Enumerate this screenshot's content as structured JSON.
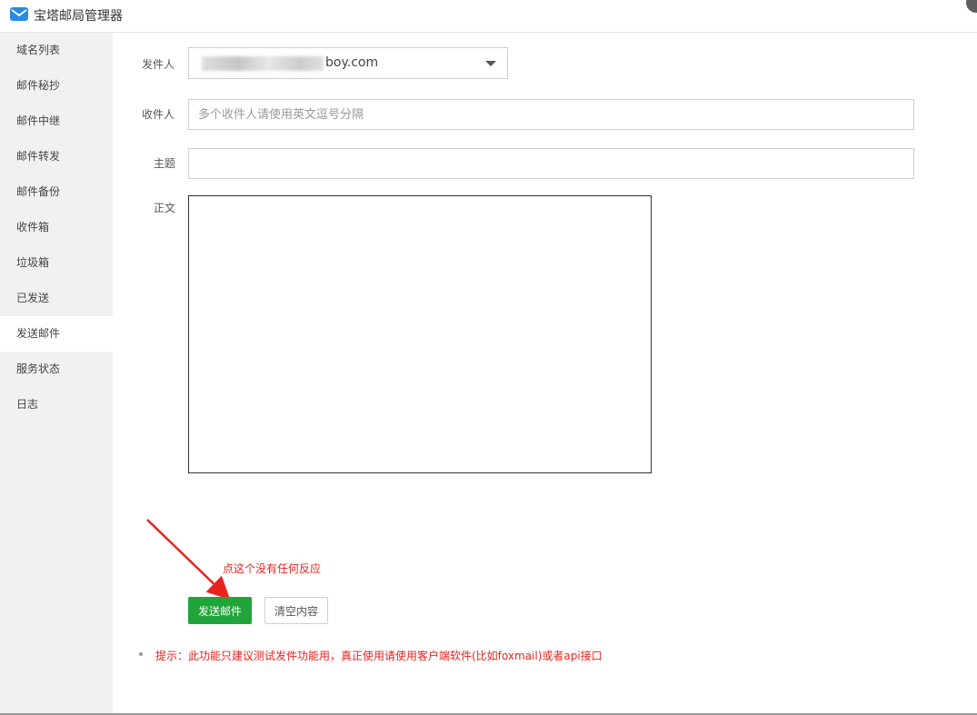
{
  "window": {
    "title": "宝塔邮局管理器",
    "app_icon": "mail-icon",
    "close_icon": "close-icon"
  },
  "sidebar": {
    "items": [
      {
        "label": "域名列表",
        "active": false
      },
      {
        "label": "邮件秘抄",
        "active": false
      },
      {
        "label": "邮件中继",
        "active": false
      },
      {
        "label": "邮件转发",
        "active": false
      },
      {
        "label": "邮件备份",
        "active": false
      },
      {
        "label": "收件箱",
        "active": false
      },
      {
        "label": "垃圾箱",
        "active": false
      },
      {
        "label": "已发送",
        "active": false
      },
      {
        "label": "发送邮件",
        "active": true
      },
      {
        "label": "服务状态",
        "active": false
      },
      {
        "label": "日志",
        "active": false
      }
    ]
  },
  "form": {
    "sender_label": "发件人",
    "sender_value": "boy.com",
    "recipient_label": "收件人",
    "recipient_placeholder": "多个收件人请使用英文逗号分隔",
    "recipient_value": "",
    "subject_label": "主题",
    "subject_value": "",
    "body_label": "正文",
    "body_value": ""
  },
  "annotation": {
    "text": "点这个没有任何反应",
    "color": "#e8231e"
  },
  "buttons": {
    "send_label": "发送邮件",
    "clear_label": "清空内容"
  },
  "tip": {
    "text": "提示：此功能只建议测试发件功能用，真正使用请使用客户端软件(比如foxmail)或者api接口"
  },
  "colors": {
    "accent_green": "#20a53a",
    "sidebar_bg": "#f1f1f1",
    "warning_red": "#e8231e"
  }
}
